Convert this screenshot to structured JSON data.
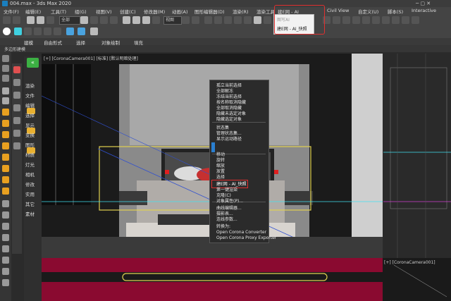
{
  "window": {
    "title": "004.max - 3ds Max 2020"
  },
  "menu": {
    "items": [
      "文件(F)",
      "编辑(E)",
      "工具(T)",
      "组(G)",
      "视图(V)",
      "创建(C)",
      "修改器(M)",
      "动画(A)",
      "图形编辑器(D)",
      "渲染(R)",
      "渲染工具",
      "建E网 - AI",
      "Civil View",
      "自定义(U)",
      "脚本(S)",
      "Interactive"
    ]
  },
  "dropdown": {
    "items": [
      "图写AI",
      "建E网 - AI_快照"
    ]
  },
  "toolbar": {
    "selection_filter": "全部",
    "view_select": "视图"
  },
  "ribbon": {
    "tabs": [
      "建模",
      "自由形式",
      "选择",
      "对象绘制",
      "填充"
    ],
    "subtitle": "多边形建模"
  },
  "viewport": {
    "label": "[+] [CoronaCamera001] [标准] [默认明暗处理]"
  },
  "rightvp_label": "[+] [CoronaCamera001]",
  "sidepanel": {
    "items": [
      "渲染",
      "文件",
      "编辑",
      "选择",
      "显示",
      "变换",
      "图形",
      "材质",
      "灯光",
      "相机",
      "修改",
      "实用",
      "其它",
      "素材"
    ]
  },
  "context_menu": {
    "items": [
      "孤立当前选择",
      "全部解冻",
      "冻结当前选择",
      "按名称取消隐藏",
      "全部取消隐藏",
      "隐藏未选定对象",
      "隐藏选定对象",
      "状态集",
      "管理状态集...",
      "显示运动路径",
      "移动",
      "旋转",
      "缩放",
      "放置",
      "选择",
      "克隆(C)",
      "对象属性(P)...",
      "曲线编辑器...",
      "摄影表...",
      "连线参数...",
      "转换为:",
      "Open Corona Converter",
      "Open Corona Proxy Exporter",
      "建E网 - AI_快照",
      "第一键渲染"
    ],
    "highlighted": "建E网 - AI_快照"
  },
  "colors": {
    "accent": "#4aa3df",
    "highlight_box": "#e03030",
    "green_logo": "#3cb043"
  }
}
